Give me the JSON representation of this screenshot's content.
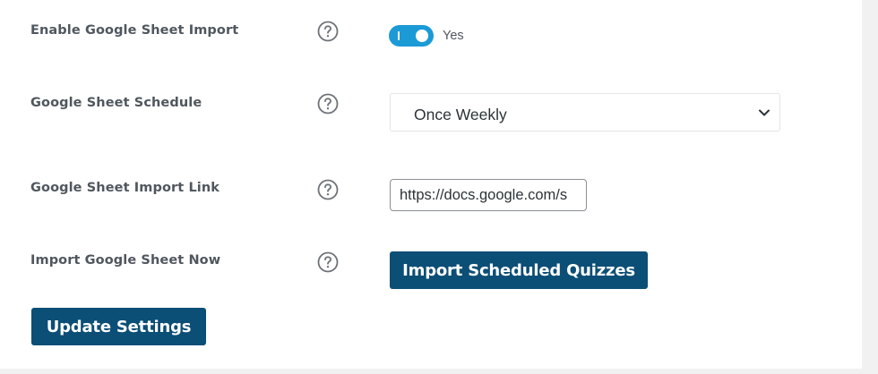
{
  "settings": {
    "enable_import": {
      "label": "Enable Google Sheet Import",
      "toggle_state_text": "Yes",
      "enabled": true,
      "help_icon": "question-circle-icon"
    },
    "schedule": {
      "label": "Google Sheet Schedule",
      "selected": "Once Weekly",
      "help_icon": "question-circle-icon",
      "dropdown_icon": "chevron-down-icon"
    },
    "import_link": {
      "label": "Google Sheet Import Link",
      "value": "https://docs.google.com/s",
      "help_icon": "question-circle-icon"
    },
    "import_now": {
      "label": "Import Google Sheet Now",
      "button_label": "Import Scheduled Quizzes",
      "help_icon": "question-circle-icon"
    }
  },
  "actions": {
    "update_label": "Update Settings"
  },
  "colors": {
    "toggle_on": "#1b9ad6",
    "button_bg": "#0b4e76",
    "label_text": "#50575e"
  }
}
